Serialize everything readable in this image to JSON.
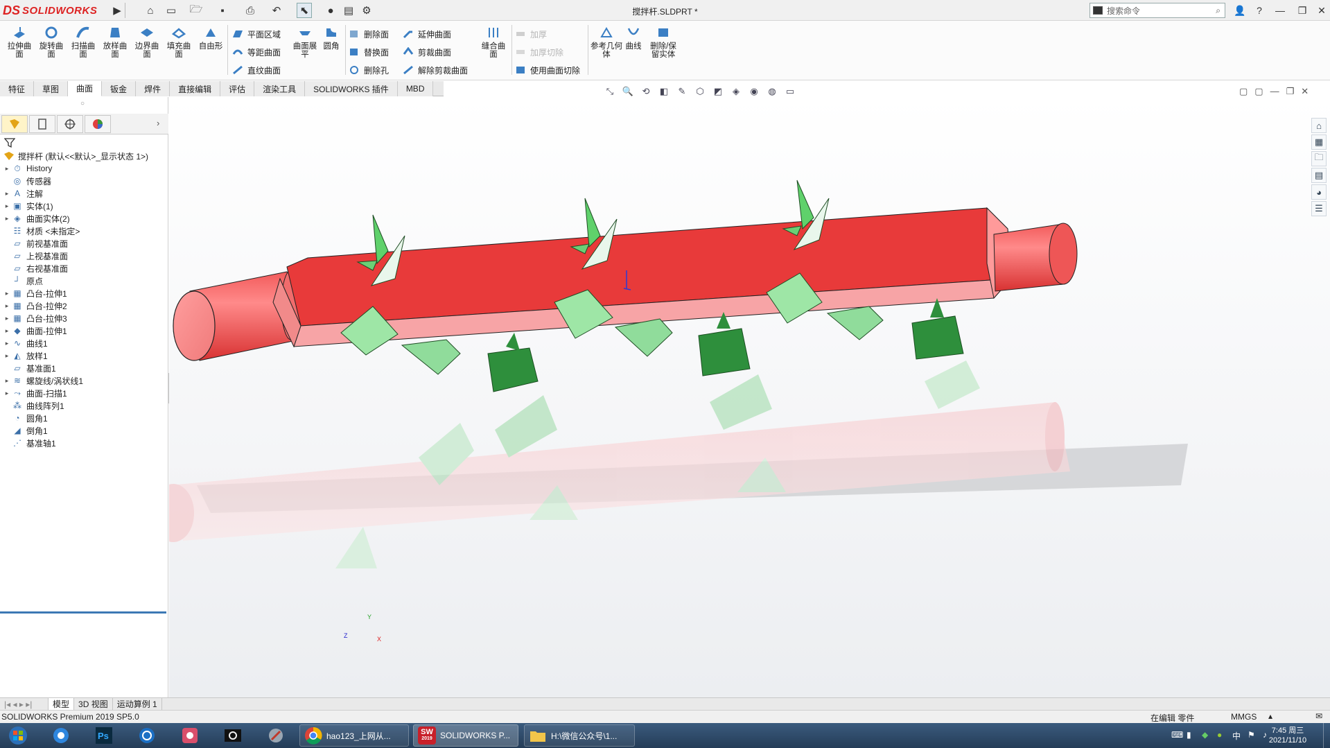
{
  "app": {
    "brand_ds": "DS",
    "brand_name": "SOLIDWORKS",
    "document_title": "搅拌杆.SLDPRT *",
    "search_placeholder": "搜索命令",
    "help_label": "?"
  },
  "ribbon": {
    "large_tools": [
      {
        "label": "拉伸曲面",
        "icon": "extruded-surface-icon"
      },
      {
        "label": "旋转曲面",
        "icon": "revolved-surface-icon"
      },
      {
        "label": "扫描曲面",
        "icon": "swept-surface-icon"
      },
      {
        "label": "放样曲面",
        "icon": "lofted-surface-icon"
      },
      {
        "label": "边界曲面",
        "icon": "boundary-surface-icon"
      },
      {
        "label": "填充曲面",
        "icon": "filled-surface-icon"
      },
      {
        "label": "自由形",
        "icon": "freeform-icon"
      }
    ],
    "col1": [
      "平面区域",
      "等距曲面",
      "直纹曲面"
    ],
    "flatten": "曲面展平",
    "fillet": "圆角",
    "col2": [
      "删除面",
      "替换面",
      "删除孔"
    ],
    "col3": [
      "延伸曲面",
      "剪裁曲面",
      "解除剪裁曲面"
    ],
    "knit": "缝合曲面",
    "col4_disabled": [
      "加厚",
      "加厚切除"
    ],
    "col4_cut": "使用曲面切除",
    "ref_geometry": "参考几何体",
    "curves": "曲线",
    "delete_keep": "删除/保留实体"
  },
  "tabs": [
    "特征",
    "草图",
    "曲面",
    "钣金",
    "焊件",
    "直接编辑",
    "评估",
    "渲染工具",
    "SOLIDWORKS 插件",
    "MBD"
  ],
  "active_tab": "曲面",
  "tree": {
    "root": "搅拌杆  (默认<<默认>_显示状态 1>)",
    "items": [
      {
        "label": "History",
        "expand": true,
        "icon": "history-icon"
      },
      {
        "label": "传感器",
        "expand": false,
        "icon": "sensor-icon"
      },
      {
        "label": "注解",
        "expand": true,
        "icon": "annotation-icon"
      },
      {
        "label": "实体(1)",
        "expand": true,
        "icon": "solid-bodies-icon"
      },
      {
        "label": "曲面实体(2)",
        "expand": true,
        "icon": "surface-bodies-icon"
      },
      {
        "label": "材质 <未指定>",
        "expand": false,
        "icon": "material-icon"
      },
      {
        "label": "前视基准面",
        "expand": false,
        "icon": "plane-icon"
      },
      {
        "label": "上视基准面",
        "expand": false,
        "icon": "plane-icon"
      },
      {
        "label": "右视基准面",
        "expand": false,
        "icon": "plane-icon"
      },
      {
        "label": "原点",
        "expand": false,
        "icon": "origin-icon"
      },
      {
        "label": "凸台-拉伸1",
        "expand": true,
        "icon": "boss-extrude-icon"
      },
      {
        "label": "凸台-拉伸2",
        "expand": true,
        "icon": "boss-extrude-icon"
      },
      {
        "label": "凸台-拉伸3",
        "expand": true,
        "icon": "boss-extrude-icon"
      },
      {
        "label": "曲面-拉伸1",
        "expand": true,
        "icon": "surface-extrude-icon"
      },
      {
        "label": "曲线1",
        "expand": true,
        "icon": "curve-icon"
      },
      {
        "label": "放样1",
        "expand": true,
        "icon": "loft-icon"
      },
      {
        "label": "基准面1",
        "expand": false,
        "icon": "plane-icon"
      },
      {
        "label": "螺旋线/涡状线1",
        "expand": true,
        "icon": "helix-icon"
      },
      {
        "label": "曲面-扫描1",
        "expand": true,
        "icon": "surface-sweep-icon"
      },
      {
        "label": "曲线阵列1",
        "expand": false,
        "icon": "curve-pattern-icon"
      },
      {
        "label": "圆角1",
        "expand": false,
        "icon": "fillet-icon"
      },
      {
        "label": "倒角1",
        "expand": false,
        "icon": "chamfer-icon"
      },
      {
        "label": "基准轴1",
        "expand": false,
        "icon": "axis-icon"
      }
    ]
  },
  "bottom_tabs": [
    "模型",
    "3D 视图",
    "运动算例 1"
  ],
  "status": {
    "version": "SOLIDWORKS Premium 2019 SP5.0",
    "mode": "在编辑 零件",
    "units": "MMGS"
  },
  "triad": {
    "x": "X",
    "y": "Y",
    "z": "Z"
  },
  "taskbar": {
    "apps": [
      {
        "label": "hao123_上网从...",
        "icon": "chrome-icon"
      },
      {
        "label": "SOLIDWORKS P...",
        "icon": "solidworks-icon"
      },
      {
        "label": "H:\\微信公众号\\1...",
        "icon": "folder-icon"
      }
    ],
    "time": "7:45 周三",
    "date": "2021/11/10",
    "sw_badge": "2019"
  },
  "colors": {
    "shaft_top": "#e83a3a",
    "shaft_side": "#f7a4a6",
    "blade_green": "#4cbf5a",
    "paddle_dark": "#2e8f3c",
    "accent_blue": "#3c78b4"
  }
}
